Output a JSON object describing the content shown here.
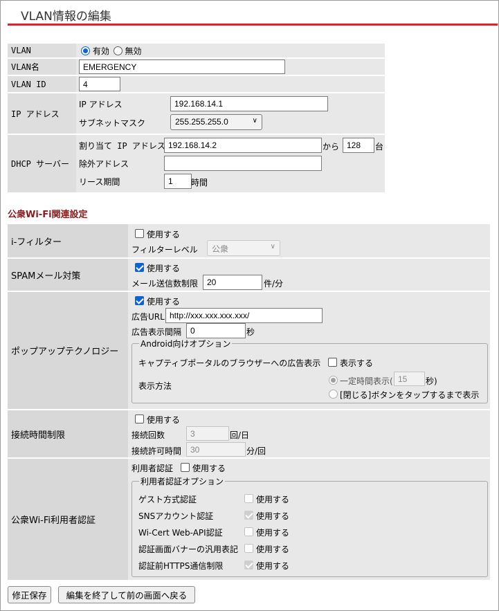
{
  "page": {
    "title": "VLAN情報の編集"
  },
  "vlan": {
    "labels": {
      "vlan": "VLAN",
      "vlan_name": "VLAN名",
      "vlan_id": "VLAN ID",
      "ip_address": "IP アドレス",
      "dhcp_server": "DHCP サーバー"
    },
    "enabled_label": "有効",
    "disabled_label": "無効",
    "status": "有効",
    "name_value": "EMERGENCY",
    "id_value": "4",
    "ip": {
      "ip_label": "IP アドレス",
      "ip_value": "192.168.14.1",
      "subnet_label": "サブネットマスク",
      "subnet_value": "255.255.255.0"
    },
    "dhcp": {
      "assign_label": "割り当て IP アドレス",
      "assign_value": "192.168.14.2",
      "from_label": "から",
      "count_value": "128",
      "count_unit": "台",
      "exclude_label": "除外アドレス",
      "exclude_value": "",
      "lease_label": "リース期間",
      "lease_value": "1",
      "lease_unit": "時間"
    }
  },
  "wifi_section": {
    "heading": "公衆Wi-Fi関連設定",
    "ifilter": {
      "label": "i-フィルター",
      "use_label": "使用する",
      "use_checked": false,
      "level_label": "フィルターレベル",
      "level_value": "公衆"
    },
    "spam": {
      "label": "SPAMメール対策",
      "use_label": "使用する",
      "use_checked": true,
      "limit_label": "メール送信数制限",
      "limit_value": "20",
      "limit_unit": "件/分"
    },
    "popup": {
      "label": "ポップアップテクノロジー",
      "use_label": "使用する",
      "use_checked": true,
      "url_label": "広告URL",
      "url_value": "http://xxx.xxx.xxx.xxx/",
      "interval_label": "広告表示間隔",
      "interval_value": "0",
      "interval_unit": "秒",
      "android_legend": "Android向けオプション",
      "captive_label": "キャプティブポータルのブラウザーへの広告表示",
      "captive_check_label": "表示する",
      "method_label": "表示方法",
      "method_timed_label": "一定時間表示(",
      "method_timed_value": "15",
      "method_timed_unit": "秒)",
      "method_close_label": "[閉じる]ボタンをタップするまで表示"
    },
    "conn_limit": {
      "label": "接続時間制限",
      "use_label": "使用する",
      "use_checked": false,
      "count_label": "接続回数",
      "count_value": "3",
      "count_unit": "回/日",
      "time_label": "接続許可時間",
      "time_value": "30",
      "time_unit": "分/回"
    },
    "auth": {
      "label": "公衆Wi-Fi利用者認証",
      "user_auth_label": "利用者認証",
      "use_label": "使用する",
      "options_legend": "利用者認証オプション",
      "options": [
        {
          "label": "ゲスト方式認証",
          "check_label": "使用する",
          "checked": false
        },
        {
          "label": "SNSアカウント認証",
          "check_label": "使用する",
          "checked": true
        },
        {
          "label": "Wi-Cert Web-API認証",
          "check_label": "使用する",
          "checked": false
        },
        {
          "label": "認証画面バナーの汎用表記",
          "check_label": "使用する",
          "checked": false
        },
        {
          "label": "認証前HTTPS通信制限",
          "check_label": "使用する",
          "checked": true
        }
      ]
    }
  },
  "buttons": {
    "save": "修正保存",
    "back": "編集を終了して前の画面へ戻る"
  },
  "colors": {
    "title_rule": "#d7262b",
    "section_heading": "#8b1a1a",
    "accent": "#0a64d8"
  }
}
